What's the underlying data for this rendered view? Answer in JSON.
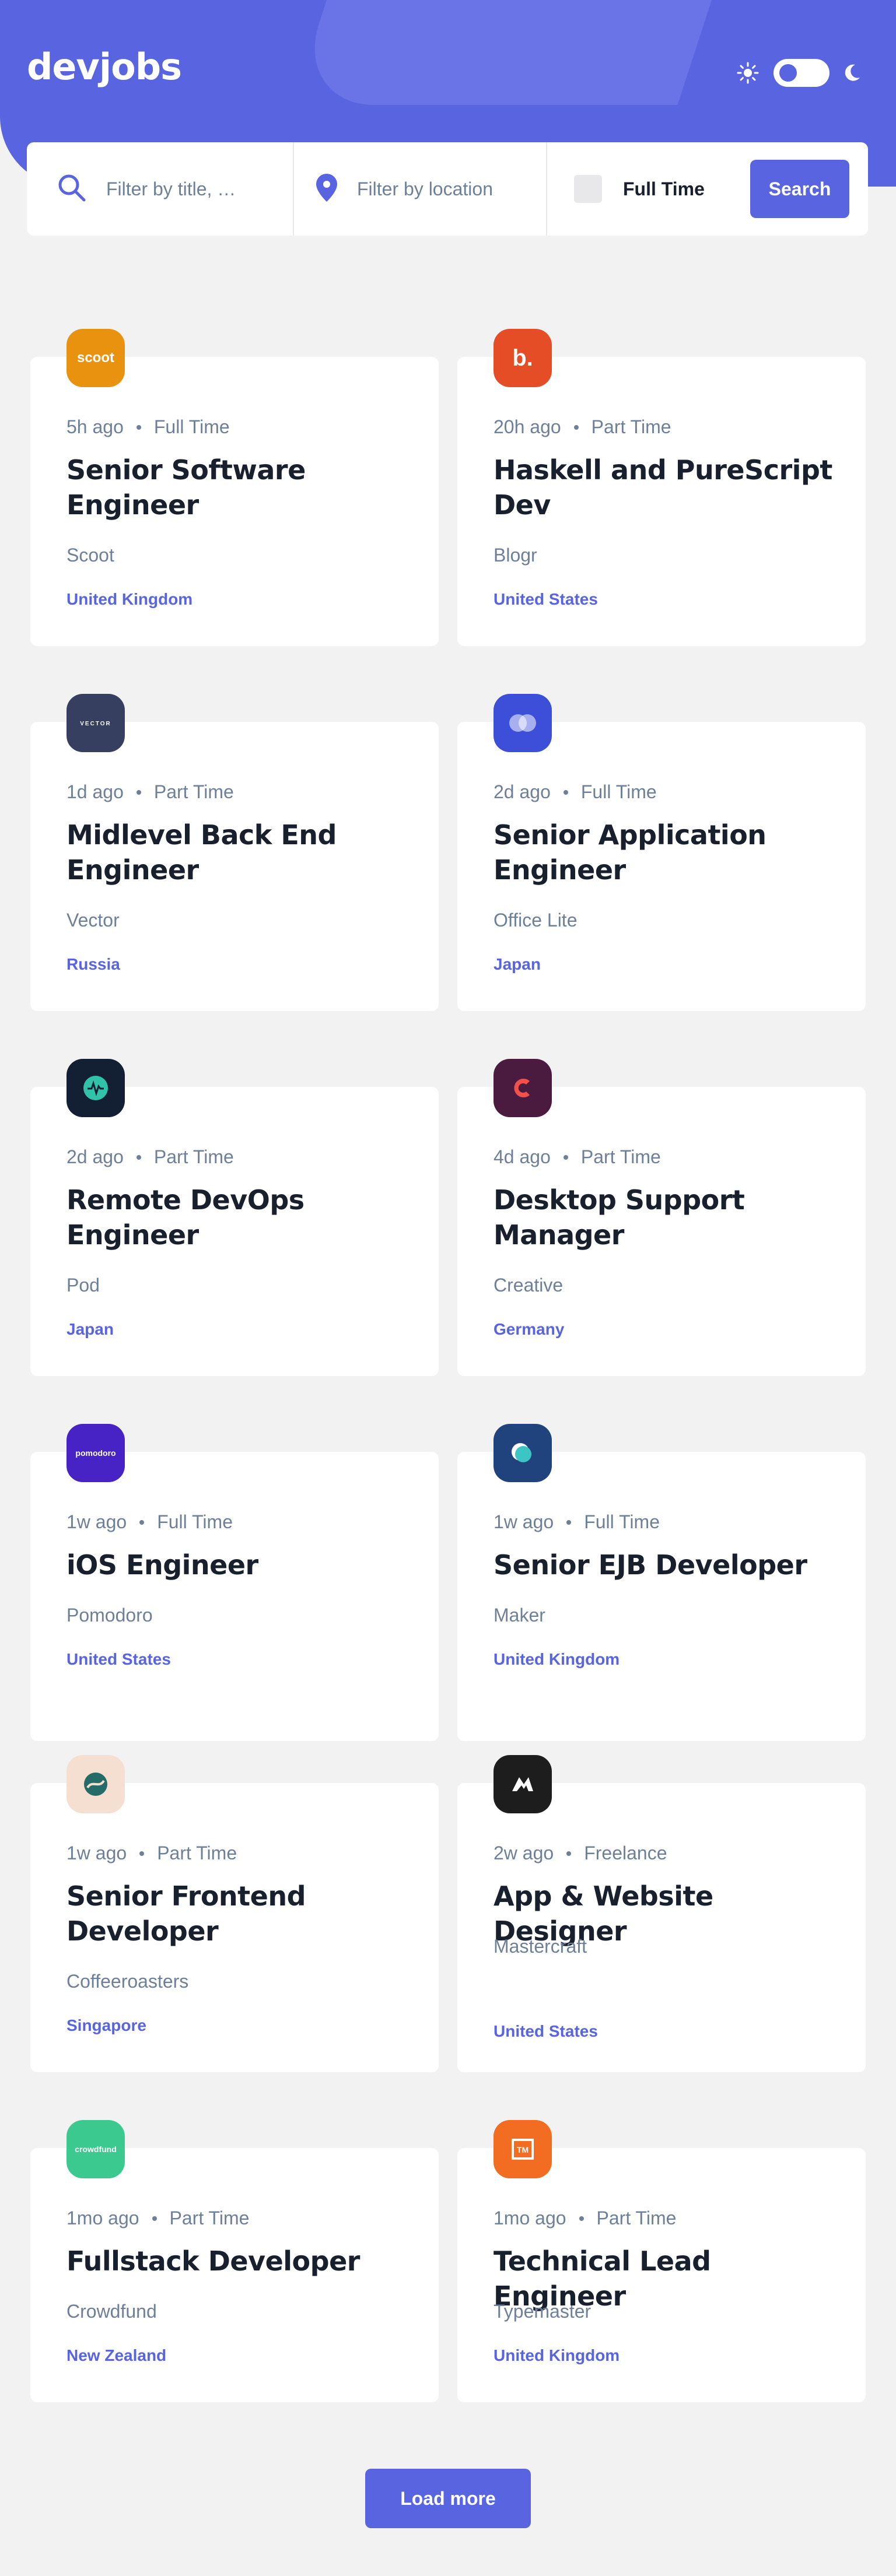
{
  "header": {
    "logo": "devjobs",
    "theme": {
      "mode": "light",
      "sun_icon": "sun-icon",
      "moon_icon": "moon-icon"
    },
    "colors": {
      "primary": "#5964E0",
      "background": "#F2F2F3",
      "text": "#19202D",
      "muted": "#6E8098"
    }
  },
  "search": {
    "title_placeholder": "Filter by title, …",
    "location_placeholder": "Filter by location",
    "full_time_label": "Full Time",
    "full_time_checked": false,
    "button_label": "Search"
  },
  "jobs": [
    {
      "company": "Scoot",
      "logo_text": "scoot",
      "logo_bg": "#E99210",
      "posted": "5h ago",
      "contract": "Full Time",
      "position": "Senior Software Engineer",
      "location": "United Kingdom"
    },
    {
      "company": "Blogr",
      "logo_text": "b.",
      "logo_bg": "#E54D26",
      "posted": "20h ago",
      "contract": "Part Time",
      "position": "Haskell and PureScript Dev",
      "location": "United States"
    },
    {
      "company": "Vector",
      "logo_text": "VECTOR",
      "logo_bg": "#363F5F",
      "posted": "1d ago",
      "contract": "Part Time",
      "position": "Midlevel Back End Engineer",
      "location": "Russia"
    },
    {
      "company": "Office Lite",
      "logo_text": "",
      "logo_bg": "#3D4ED9",
      "posted": "2d ago",
      "contract": "Full Time",
      "position": "Senior Application Engineer",
      "location": "Japan"
    },
    {
      "company": "Pod",
      "logo_text": "",
      "logo_bg": "#132034",
      "posted": "2d ago",
      "contract": "Part Time",
      "position": "Remote DevOps Engineer",
      "location": "Japan"
    },
    {
      "company": "Creative",
      "logo_text": "",
      "logo_bg": "#4B1A3F",
      "posted": "4d ago",
      "contract": "Part Time",
      "position": "Desktop Support Manager",
      "location": "Germany"
    },
    {
      "company": "Pomodoro",
      "logo_text": "pomodoro",
      "logo_bg": "#4722C4",
      "posted": "1w ago",
      "contract": "Full Time",
      "position": "iOS Engineer",
      "location": "United States"
    },
    {
      "company": "Maker",
      "logo_text": "",
      "logo_bg": "#21437D",
      "posted": "1w ago",
      "contract": "Full Time",
      "position": "Senior EJB Developer",
      "location": "United Kingdom"
    },
    {
      "company": "Coffeeroasters",
      "logo_text": "",
      "logo_bg": "#F4DFD0",
      "posted": "1w ago",
      "contract": "Part Time",
      "position": "Senior Frontend Developer",
      "location": "Singapore"
    },
    {
      "company": "Mastercraft",
      "logo_text": "",
      "logo_bg": "#1D1D1D",
      "posted": "2w ago",
      "contract": "Freelance",
      "position": "App & Website Designer",
      "location": "United States"
    },
    {
      "company": "Crowdfund",
      "logo_text": "crowdfund",
      "logo_bg": "#3CC98F",
      "posted": "1mo ago",
      "contract": "Part Time",
      "position": "Fullstack Developer",
      "location": "New Zealand"
    },
    {
      "company": "Typemaster",
      "logo_text": "TM",
      "logo_bg": "#F26C21",
      "posted": "1mo ago",
      "contract": "Part Time",
      "position": "Technical Lead Engineer",
      "location": "United Kingdom"
    }
  ],
  "load_more_label": "Load more"
}
